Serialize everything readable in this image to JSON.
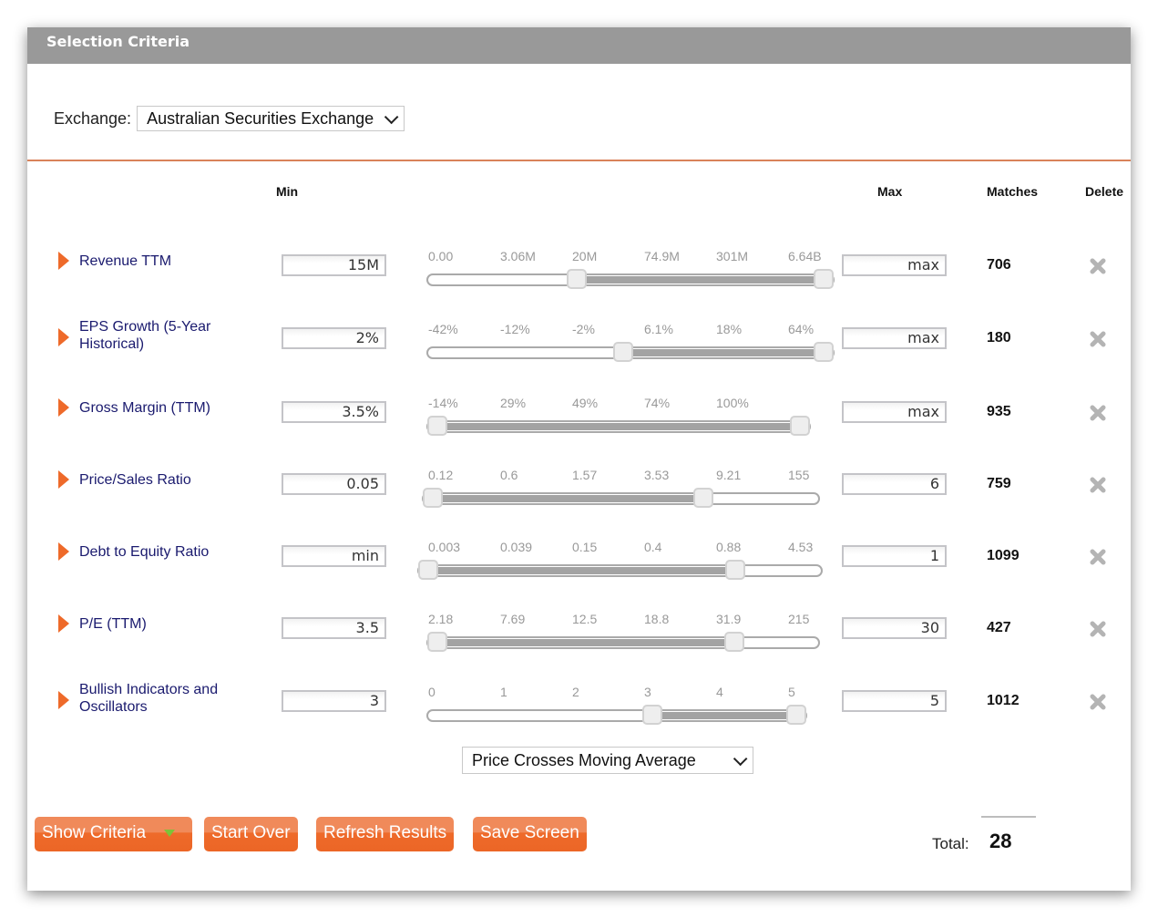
{
  "panel": {
    "title": "Selection Criteria"
  },
  "exchange": {
    "label": "Exchange:",
    "selected": "Australian Securities Exchange"
  },
  "columns": {
    "min": "Min",
    "max": "Max",
    "matches": "Matches",
    "delete": "Delete"
  },
  "criteria": [
    {
      "label": "Revenue TTM",
      "min": "15M",
      "max": "max",
      "ticks": [
        "0.00",
        "3.06M",
        "20M",
        "74.9M",
        "301M",
        "6.64B"
      ],
      "range_low_fraction": 0.36,
      "range_high_fraction": 1.0,
      "matches": "706"
    },
    {
      "label": "EPS Growth (5-Year Historical)",
      "min": "2%",
      "max": "max",
      "ticks": [
        "-42%",
        "-12%",
        "-2%",
        "6.1%",
        "18%",
        "64%"
      ],
      "range_low_fraction": 0.48,
      "range_high_fraction": 1.0,
      "matches": "180"
    },
    {
      "label": "Gross Margin (TTM)",
      "min": "3.5%",
      "max": "max",
      "ticks": [
        "-14%",
        "29%",
        "49%",
        "74%",
        "100%"
      ],
      "range_low_fraction": 0.0,
      "range_high_fraction": 1.0,
      "matches": "935"
    },
    {
      "label": "Price/Sales Ratio",
      "min": "0.05",
      "max": "6",
      "ticks": [
        "0.12",
        "0.6",
        "1.57",
        "3.53",
        "9.21",
        "155"
      ],
      "range_low_fraction": 0.0,
      "range_high_fraction": 0.72,
      "matches": "759"
    },
    {
      "label": "Debt to Equity Ratio",
      "min": "min",
      "max": "1",
      "ticks": [
        "0.003",
        "0.039",
        "0.15",
        "0.4",
        "0.88",
        "4.53"
      ],
      "range_low_fraction": 0.0,
      "range_high_fraction": 0.8,
      "matches": "1099"
    },
    {
      "label": "P/E (TTM)",
      "min": "3.5",
      "max": "30",
      "ticks": [
        "2.18",
        "7.69",
        "12.5",
        "18.8",
        "31.9",
        "215"
      ],
      "range_low_fraction": 0.0,
      "range_high_fraction": 0.8,
      "matches": "427"
    },
    {
      "label": "Bullish Indicators and Oscillators",
      "min": "3",
      "max": "5",
      "ticks": [
        "0",
        "1",
        "2",
        "3",
        "4",
        "5"
      ],
      "range_low_fraction": 0.6,
      "range_high_fraction": 1.0,
      "matches": "1012",
      "sub_select": "Price Crosses Moving Average"
    }
  ],
  "buttons": {
    "show_criteria": "Show Criteria",
    "start_over": "Start Over",
    "refresh_results": "Refresh Results",
    "save_screen": "Save Screen"
  },
  "total": {
    "label": "Total:",
    "value": "28"
  },
  "icons": {
    "criteria_expand": "triangle-right-icon",
    "delete": "x-icon",
    "dropdown": "chevron-down-icon",
    "show_criteria": "triangle-down-icon"
  },
  "colors": {
    "accent_orange": "#ee6a2a",
    "header_gray": "#999999",
    "label_navy": "#1a1a6e",
    "slider_fill": "#a3a3a3",
    "show_criteria_indicator": "#7cc338"
  }
}
